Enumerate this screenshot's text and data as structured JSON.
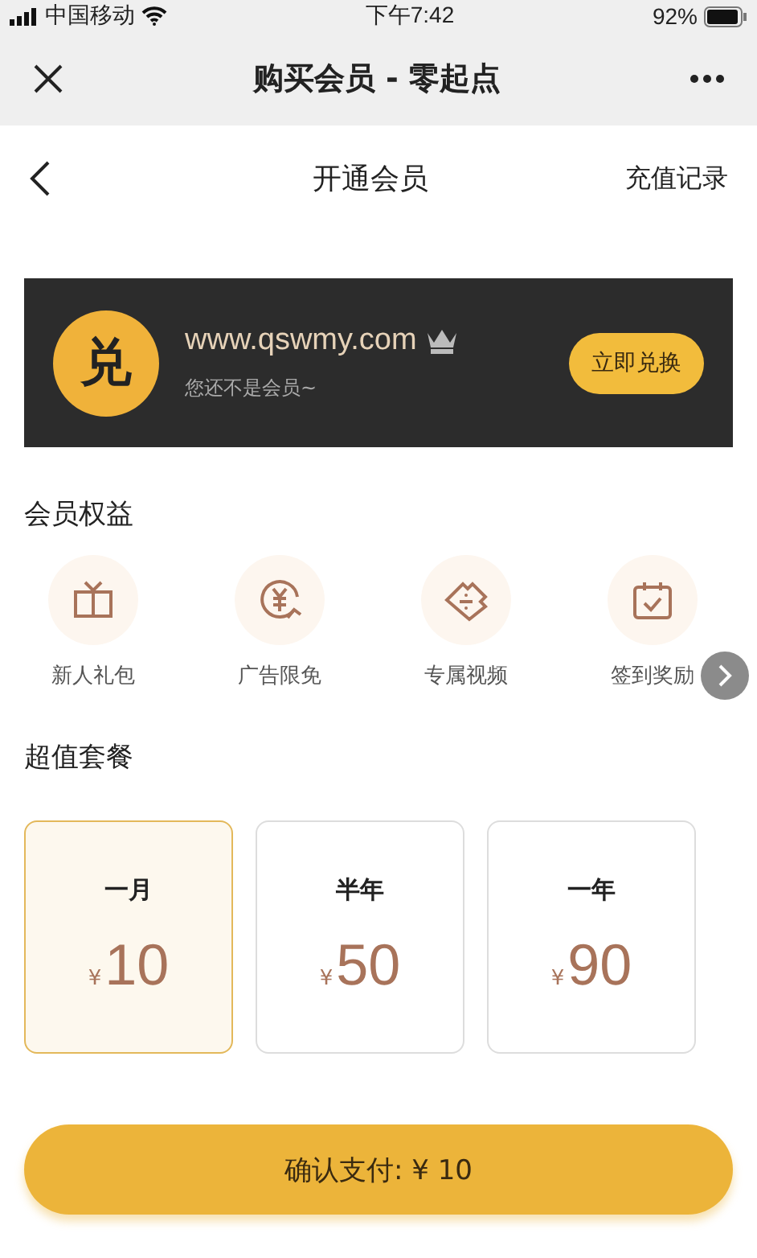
{
  "status_bar": {
    "carrier": "中国移动",
    "time": "下午7:42",
    "battery": "92%"
  },
  "nav_bar": {
    "title": "购买会员 - 零起点"
  },
  "header": {
    "title": "开通会员",
    "action": "充值记录"
  },
  "banner": {
    "badge": "兑",
    "site": "www.qswmy.com",
    "note": "您还不是会员~",
    "button": "立即兑换"
  },
  "benefits": {
    "title": "会员权益",
    "items": [
      {
        "label": "新人礼包",
        "kind": "gift"
      },
      {
        "label": "广告限免",
        "kind": "coin"
      },
      {
        "label": "专属视频",
        "kind": "ticket"
      },
      {
        "label": "签到奖励",
        "kind": "calendar"
      }
    ]
  },
  "plans": {
    "title": "超值套餐",
    "items": [
      {
        "name": "一月",
        "currency": "¥",
        "price": "10",
        "selected": true
      },
      {
        "name": "半年",
        "currency": "¥",
        "price": "50",
        "selected": false
      },
      {
        "name": "一年",
        "currency": "¥",
        "price": "90",
        "selected": false
      }
    ]
  },
  "pay_button": "确认支付: ¥ 10"
}
